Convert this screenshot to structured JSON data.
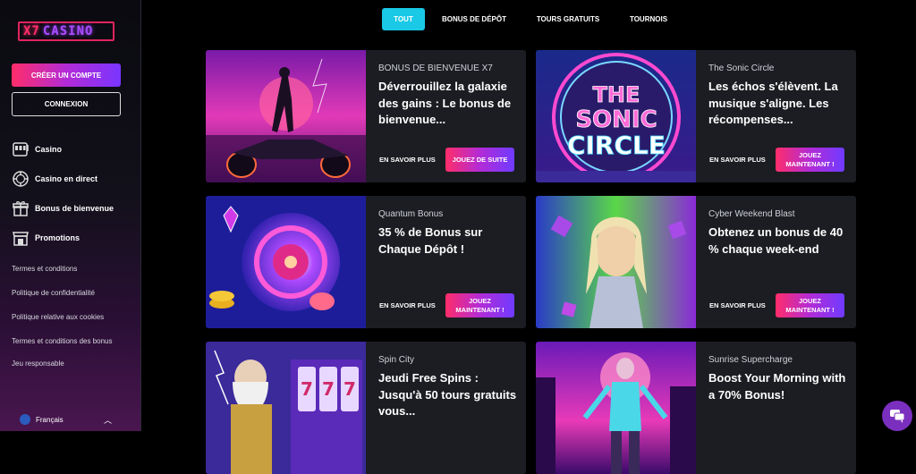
{
  "brand": {
    "logo_x7": "X7",
    "logo_casino": "CASINO"
  },
  "sidebar": {
    "create_account": "CRÉER UN COMPTE",
    "login": "CONNEXION",
    "nav": [
      {
        "label": "Casino",
        "icon": "slot-machine-icon"
      },
      {
        "label": "Casino en direct",
        "icon": "chip-icon"
      },
      {
        "label": "Bonus de bienvenue",
        "icon": "gift-icon"
      },
      {
        "label": "Promotions",
        "icon": "shop-icon"
      }
    ],
    "links": [
      "Termes et conditions",
      "Politique de confidentialité",
      "Politique relative aux cookies",
      "Termes et conditions des bonus",
      "Jeu responsable"
    ],
    "language": "Français"
  },
  "tabs": [
    "TOUT",
    "BONUS DE DÉPÔT",
    "TOURS GRATUITS",
    "TOURNOIS"
  ],
  "cards": [
    {
      "category": "BONUS DE BIENVENUE X7",
      "title": "Déverrouillez la galaxie des gains : Le bonus de bienvenue...",
      "more": "EN SAVOIR PLUS",
      "play": "JOUEZ DE SUITE"
    },
    {
      "category": "The Sonic Circle",
      "title": "Les échos s'élèvent. La musique s'aligne. Les récompenses...",
      "more": "EN SAVOIR PLUS",
      "play": "JOUEZ MAINTENANT !"
    },
    {
      "category": "Quantum Bonus",
      "title": "35 % de Bonus sur Chaque Dépôt !",
      "more": "EN SAVOIR PLUS",
      "play": "JOUEZ MAINTENANT !"
    },
    {
      "category": "Cyber Weekend Blast",
      "title": "Obtenez un bonus de 40 % chaque week-end",
      "more": "EN SAVOIR PLUS",
      "play": "JOUEZ MAINTENANT !"
    },
    {
      "category": "Spin City",
      "title": "Jeudi Free Spins : Jusqu'à 50 tours gratuits vous..."
    },
    {
      "category": "Sunrise Supercharge",
      "title": "Boost Your Morning with a 70% Bonus!"
    }
  ],
  "images": {
    "sonic_line1": "THE",
    "sonic_line2": "SONIC",
    "sonic_line3": "CIRCLE",
    "slot_reel": "7"
  },
  "colors": {
    "accent_cyan": "#19c9e6",
    "accent_pink": "#ff2d6a",
    "accent_purple": "#7a35ff",
    "card_bg": "#1b1d22"
  }
}
